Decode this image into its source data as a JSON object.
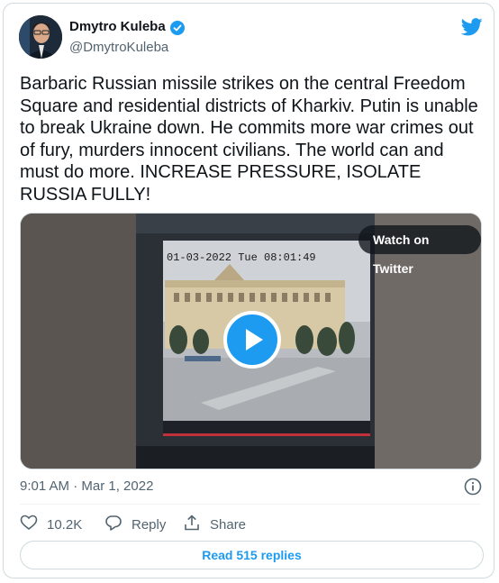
{
  "author": {
    "name": "Dmytro Kuleba",
    "handle": "@DmytroKuleba"
  },
  "tweet": {
    "text": "Barbaric Russian missile strikes on the central Freedom Square and residential districts of Kharkiv. Putin is unable to break Ukraine down. He commits more war crimes out of fury, murders innocent civilians. The world can and must do more. INCREASE PRESSURE, ISOLATE RUSSIA FULLY!",
    "timestamp": "9:01 AM · Mar 1, 2022"
  },
  "media": {
    "watch_label": "Watch on Twitter",
    "overlay_timestamp": "01-03-2022 Tue 08:01:49"
  },
  "actions": {
    "likes": "10.2K",
    "reply_label": "Reply",
    "share_label": "Share"
  },
  "replies_button": "Read 515 replies",
  "colors": {
    "accent": "#1d9bf0",
    "text": "#0f1419",
    "muted": "#536471",
    "border": "#cfd9de"
  },
  "icons": [
    "verified-badge-icon",
    "twitter-bird-icon",
    "play-icon",
    "info-icon",
    "heart-icon",
    "reply-icon",
    "share-icon"
  ]
}
